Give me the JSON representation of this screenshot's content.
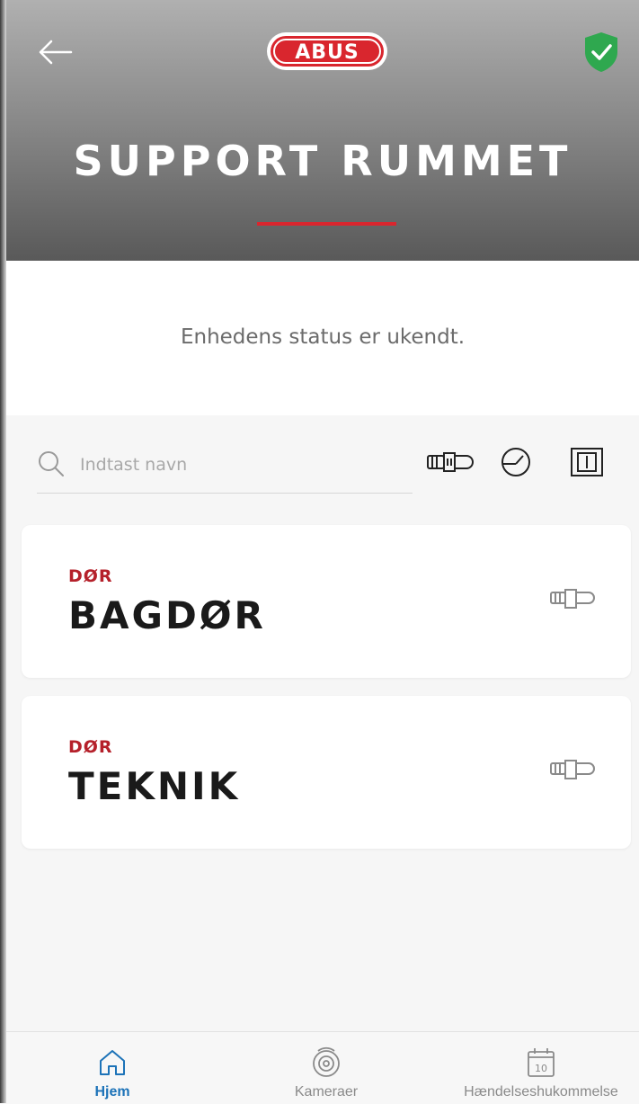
{
  "header": {
    "logo_text": "ABUS",
    "title": "SUPPORT RUMMET",
    "accent_color": "#d9262e",
    "shield_color": "#2fa84f"
  },
  "status": {
    "text": "Enhedens status er ukendt."
  },
  "search": {
    "placeholder": "Indtast navn",
    "value": ""
  },
  "filters": [
    {
      "icon": "lock-cylinder-icon"
    },
    {
      "icon": "gauge-icon"
    },
    {
      "icon": "door-frame-icon"
    }
  ],
  "devices": [
    {
      "type": "DØR",
      "name": "BAGDØR",
      "icon": "lock-cylinder-icon"
    },
    {
      "type": "DØR",
      "name": "TEKNIK",
      "icon": "lock-cylinder-icon"
    }
  ],
  "nav": {
    "items": [
      {
        "label": "Hjem",
        "icon": "home-icon",
        "active": true
      },
      {
        "label": "Kameraer",
        "icon": "camera-icon",
        "active": false
      },
      {
        "label": "Hændelseshukommelse",
        "icon": "calendar-icon",
        "active": false,
        "icon_text": "10"
      }
    ],
    "active_color": "#1d73b8"
  }
}
